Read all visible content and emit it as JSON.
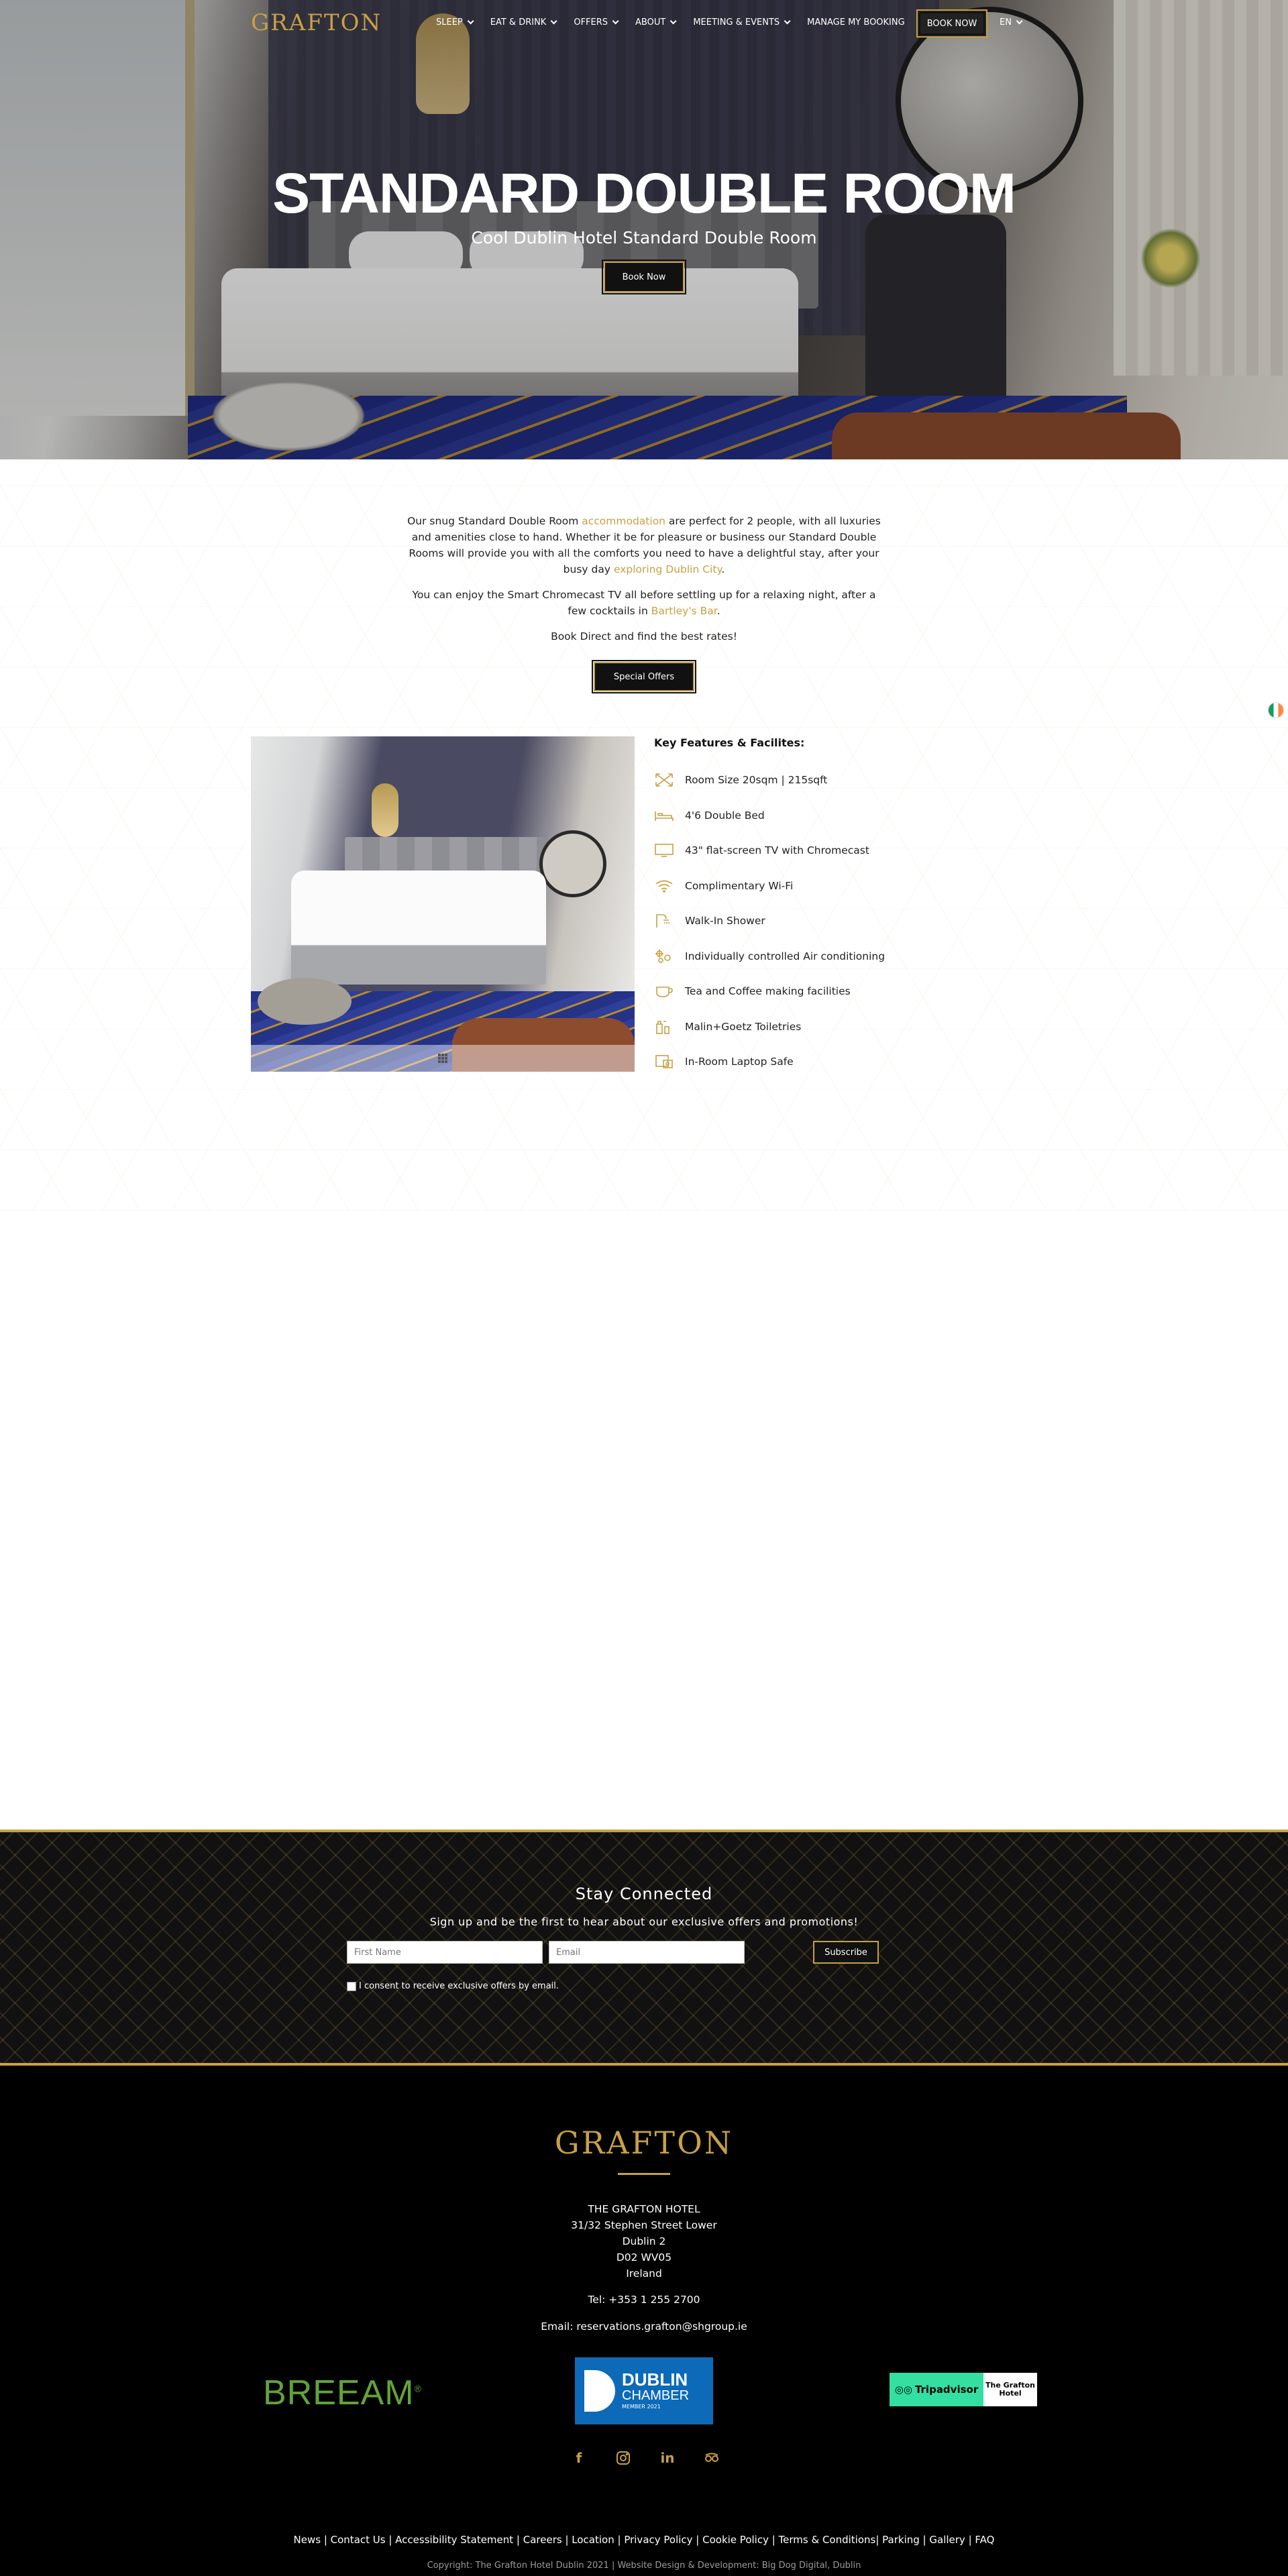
{
  "nav": {
    "logo": "GRAFTON",
    "items": [
      {
        "label": "SLEEP",
        "dropdown": true
      },
      {
        "label": "EAT & DRINK",
        "dropdown": true
      },
      {
        "label": "OFFERS",
        "dropdown": true
      },
      {
        "label": "ABOUT",
        "dropdown": true
      },
      {
        "label": "MEETING & EVENTS",
        "dropdown": true
      },
      {
        "label": "MANAGE MY BOOKING",
        "dropdown": false
      }
    ],
    "book_now": "BOOK NOW",
    "language": "EN"
  },
  "hero": {
    "title": "STANDARD DOUBLE ROOM",
    "subtitle": "Cool Dublin Hotel Standard Double Room",
    "button": "Book Now"
  },
  "intro": {
    "p1_a": "Our snug Standard Double Room ",
    "p1_link": "accommodation",
    "p1_b": " are perfect for 2 people, with all luxuries and amenities close to hand. Whether it be for pleasure or business our Standard Double Rooms will provide you with all the comforts you need to have a delightful stay, after your busy day ",
    "p1_link2": "exploring Dublin City",
    "p1_c": ".",
    "p2_a": "You can enjoy the Smart Chromecast TV all before settling up for a relaxing night, after a few cocktails in ",
    "p2_link": "Bartley's Bar",
    "p2_b": ".",
    "p3": "Book Direct and find the best rates!",
    "button": "Special Offers"
  },
  "features": {
    "heading": "Key Features & Facilites:",
    "items": [
      {
        "icon": "room-size-icon",
        "label": "Room Size 20sqm | 215sqft"
      },
      {
        "icon": "bed-icon",
        "label": "4'6 Double Bed"
      },
      {
        "icon": "tv-icon",
        "label": "43\" flat-screen TV with Chromecast"
      },
      {
        "icon": "wifi-icon",
        "label": "Complimentary Wi-Fi"
      },
      {
        "icon": "shower-icon",
        "label": "Walk-In Shower"
      },
      {
        "icon": "air-conditioning-icon",
        "label": "Individually controlled Air conditioning"
      },
      {
        "icon": "coffee-cup-icon",
        "label": "Tea and Coffee making facilities"
      },
      {
        "icon": "toiletries-icon",
        "label": "Malin+Goetz Toiletries"
      },
      {
        "icon": "laptop-safe-icon",
        "label": "In-Room Laptop Safe"
      }
    ]
  },
  "newsletter": {
    "title": "Stay Connected",
    "subtitle": "Sign up and be the first to hear about our exclusive offers and promotions!",
    "first_name_placeholder": "First Name",
    "email_placeholder": "Email",
    "button": "Subscribe",
    "consent": "I consent to receive exclusive offers by email."
  },
  "footer": {
    "logo": "GRAFTON",
    "address": [
      "THE GRAFTON HOTEL",
      "31/32 Stephen Street Lower",
      "Dublin 2",
      "D02 WV05",
      "Ireland"
    ],
    "tel": "Tel: +353 1 255 2700",
    "email": "Email: reservations.grafton@shgroup.ie",
    "breeam": "BREEAM",
    "chamber_line1": "DUBLIN",
    "chamber_line2": "CHAMBER",
    "chamber_line3": "MEMBER 2021",
    "tripadvisor": "Tripadvisor",
    "tripadvisor_hotel": "The Grafton Hotel",
    "links": "News | Contact Us | Accessibility Statement | Careers | Location | Privacy Policy | Cookie Policy | Terms & Conditions| Parking | Gallery | FAQ",
    "copyright": "Copyright: The Grafton Hotel Dublin 2021 | Website Design & Development: Big Dog Digital, Dublin"
  },
  "colors": {
    "gold": "#c8a045",
    "black": "#111111",
    "irish_flag": [
      "#169b62",
      "#ffffff",
      "#ff883e"
    ]
  }
}
